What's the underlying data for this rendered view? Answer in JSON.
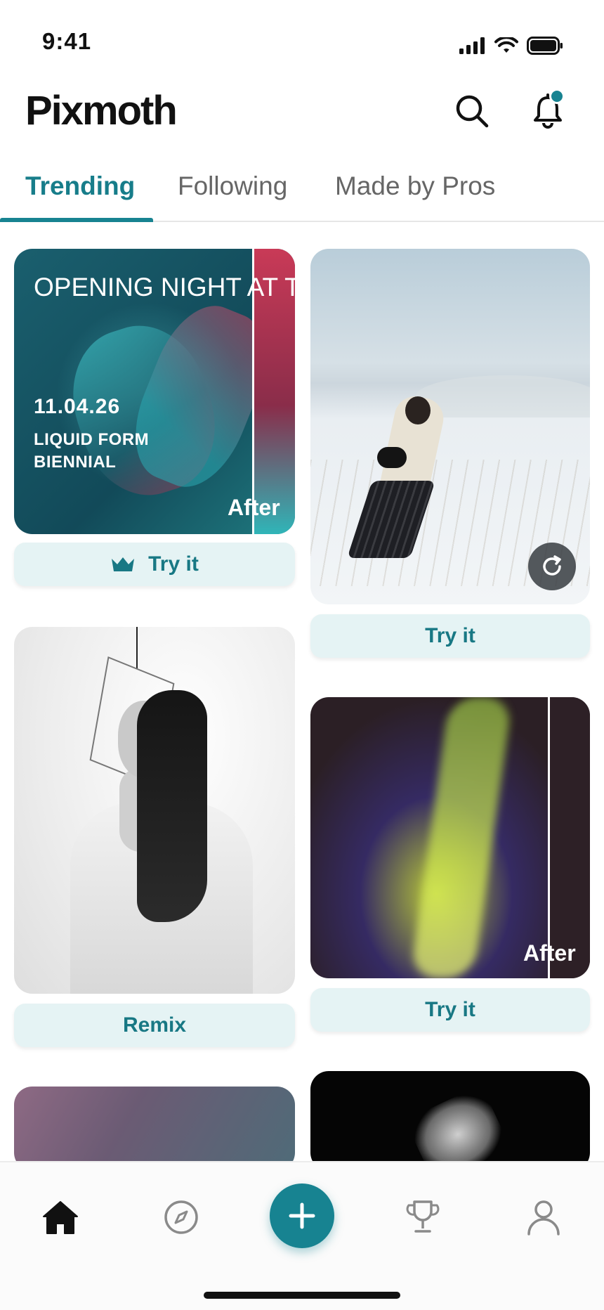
{
  "status_bar": {
    "time": "9:41"
  },
  "header": {
    "brand": "Pixmoth"
  },
  "tabs": [
    {
      "label": "Trending",
      "active": true
    },
    {
      "label": "Following",
      "active": false
    },
    {
      "label": "Made by Pros",
      "active": false
    }
  ],
  "feed": {
    "card1": {
      "title": "OPENING NIGHT AT T",
      "date": "11.04.26",
      "subtitle": "LIQUID FORM BIENNIAL",
      "after_label": "After",
      "button_label": "Try it",
      "button_icon": "crown-icon"
    },
    "card2": {
      "button_label": "Try it",
      "overlay_icon": "refresh-icon"
    },
    "card3": {
      "button_label": "Remix"
    },
    "card4": {
      "after_label": "After",
      "button_label": "Try it"
    }
  },
  "bottom_nav": {
    "items": [
      "home-icon",
      "explore-icon",
      "create-icon",
      "trophy-icon",
      "profile-icon"
    ],
    "active": "home-icon"
  },
  "colors": {
    "accent": "#178391",
    "button_bg": "#e5f3f4",
    "button_text": "#187884"
  }
}
